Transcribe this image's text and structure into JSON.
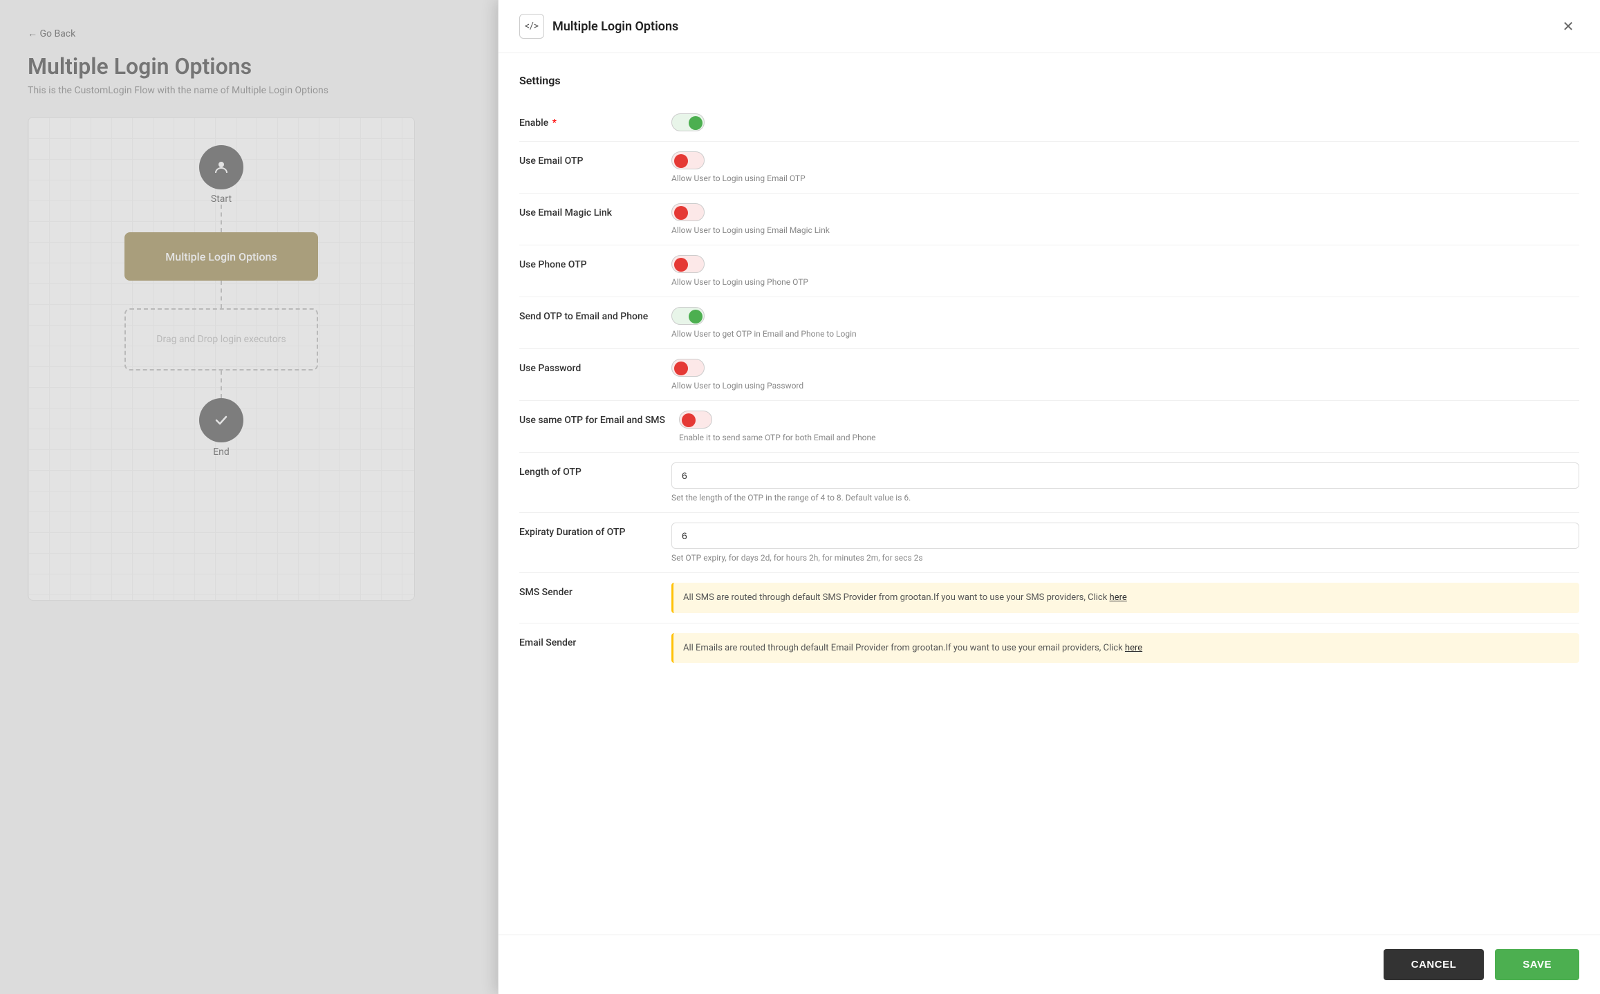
{
  "left": {
    "go_back": "← Go Back",
    "page_title": "Multiple Login Options",
    "page_subtitle": "This is the CustomLogin Flow with the name of Multiple Login Options",
    "flow": {
      "start_label": "Start",
      "box_label": "Multiple Login Options",
      "drop_zone_text": "Drag and Drop login executors",
      "end_label": "End"
    }
  },
  "panel": {
    "title": "Multiple Login Options",
    "code_icon": "</>",
    "close_icon": "✕",
    "settings_heading": "Settings",
    "settings": [
      {
        "id": "enable",
        "label": "Enable",
        "required": true,
        "toggle": "on-green",
        "help": ""
      },
      {
        "id": "use-email-otp",
        "label": "Use Email OTP",
        "required": false,
        "toggle": "off-red",
        "help": "Allow User to Login using Email OTP"
      },
      {
        "id": "use-email-magic-link",
        "label": "Use Email Magic Link",
        "required": false,
        "toggle": "off-red",
        "help": "Allow User to Login using Email Magic Link"
      },
      {
        "id": "use-phone-otp",
        "label": "Use Phone OTP",
        "required": false,
        "toggle": "off-red",
        "help": "Allow User to Login using Phone OTP"
      },
      {
        "id": "send-otp-email-phone",
        "label": "Send OTP to Email and Phone",
        "required": false,
        "toggle": "on-green",
        "help": "Allow User to get OTP in Email and Phone to Login"
      },
      {
        "id": "use-password",
        "label": "Use Password",
        "required": false,
        "toggle": "off-red",
        "help": "Allow User to Login using Password"
      },
      {
        "id": "use-same-otp",
        "label": "Use same OTP for Email and SMS",
        "required": false,
        "toggle": "off-red",
        "help": "Enable it to send same OTP for both Email and Phone"
      }
    ],
    "length_otp": {
      "label": "Length of OTP",
      "value": "6",
      "help": "Set the length of the OTP in the range of 4 to 8. Default value is 6."
    },
    "expiry_otp": {
      "label": "Expiraty Duration of OTP",
      "value": "6",
      "help": "Set OTP expiry, for days 2d, for hours 2h, for minutes 2m, for secs 2s"
    },
    "sms_sender": {
      "label": "SMS Sender",
      "info": "All SMS are routed through default SMS Provider from grootan.If you want to use your SMS providers, Click",
      "link_text": "here"
    },
    "email_sender": {
      "label": "Email Sender",
      "info": "All Emails are routed through default Email Provider from grootan.If you want to use your email providers, Click",
      "link_text": "here"
    },
    "footer": {
      "cancel_label": "CANCEL",
      "save_label": "SAVE"
    }
  }
}
